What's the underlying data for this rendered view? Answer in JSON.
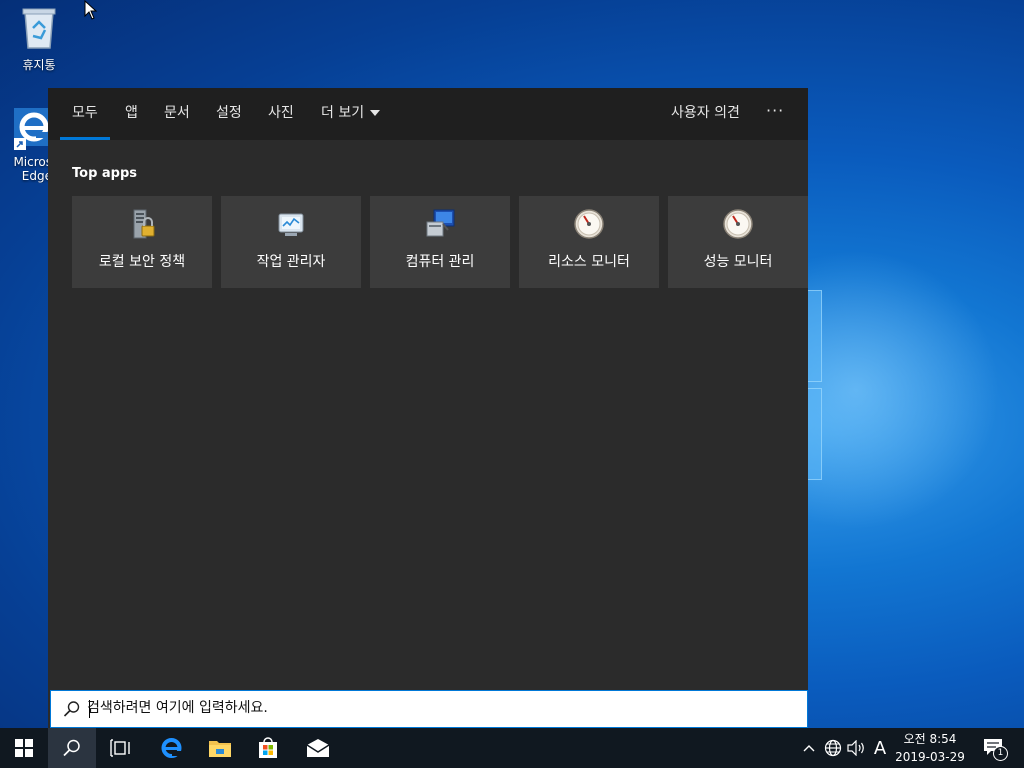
{
  "desktop": {
    "icons": [
      {
        "label": "휴지통"
      },
      {
        "label": "Micros Edge"
      }
    ]
  },
  "search_panel": {
    "tabs": [
      {
        "label": "모두",
        "active": true
      },
      {
        "label": "앱"
      },
      {
        "label": "문서"
      },
      {
        "label": "설정"
      },
      {
        "label": "사진"
      },
      {
        "label": "더 보기"
      }
    ],
    "feedback_label": "사용자 의견",
    "more_options_icon": "ellipsis-icon",
    "section_title": "Top apps",
    "top_apps": [
      {
        "label": "로컬 보안 정책",
        "icon": "security-policy-icon"
      },
      {
        "label": "작업 관리자",
        "icon": "task-manager-icon"
      },
      {
        "label": "컴퓨터 관리",
        "icon": "computer-management-icon"
      },
      {
        "label": "리소스 모니터",
        "icon": "resource-monitor-icon"
      },
      {
        "label": "성능 모니터",
        "icon": "performance-monitor-icon"
      }
    ],
    "search_placeholder": "검색하려면 여기에 입력하세요."
  },
  "taskbar": {
    "apps": [
      "start-icon",
      "search-icon",
      "task-view-icon",
      "edge-icon",
      "file-explorer-icon",
      "store-icon",
      "mail-icon"
    ],
    "tray": {
      "input_indicator": "A",
      "clock_time": "오전 8:54",
      "clock_date": "2019-03-29",
      "notification_count": "1"
    }
  },
  "colors": {
    "accent": "#0078d7",
    "panel_bg": "#2b2b2b",
    "tabbar_bg": "#1f1f1f",
    "tile_bg": "#3c3c3c",
    "taskbar_bg": "#101820"
  }
}
